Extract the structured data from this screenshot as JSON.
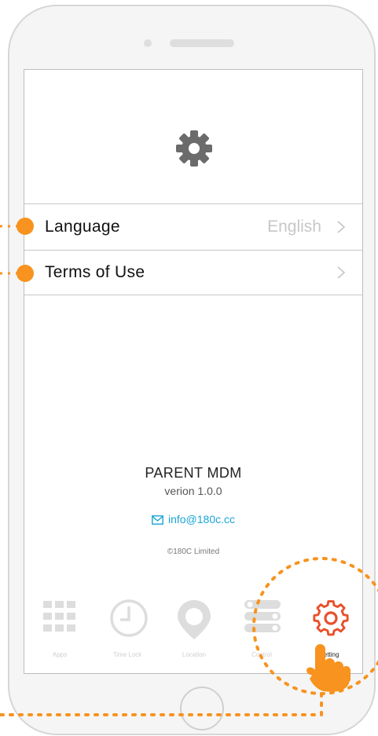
{
  "settings": {
    "rows": [
      {
        "label": "Language",
        "value": "English"
      },
      {
        "label": "Terms of Use",
        "value": ""
      }
    ]
  },
  "about": {
    "app_name": "PARENT MDM",
    "version": "verion 1.0.0",
    "email": "info@180c.cc",
    "copyright": "©180C Limited"
  },
  "tabbar": {
    "tabs": [
      {
        "label": "Apps",
        "icon": "apps-grid-icon",
        "active": false
      },
      {
        "label": "Time Lock",
        "icon": "clock-icon",
        "active": false
      },
      {
        "label": "Location",
        "icon": "location-pin-icon",
        "active": false
      },
      {
        "label": "Control",
        "icon": "toggles-icon",
        "active": false
      },
      {
        "label": "Setting",
        "icon": "gear-icon",
        "active": true
      }
    ]
  },
  "colors": {
    "accent_orange": "#f7931e",
    "active_tab_red": "#e8502a",
    "link_blue": "#1aa4d6",
    "inactive_icon": "#dddddd"
  }
}
